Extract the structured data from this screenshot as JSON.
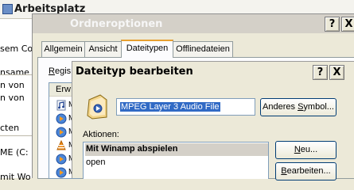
{
  "explorer": {
    "title": "Arbeitsplatz",
    "left_items": [
      "sem Co",
      "nsame",
      "n von",
      "n von",
      "cten",
      "ME (C:",
      "mit Wo"
    ]
  },
  "ordneroptionen": {
    "title": "Ordneroptionen",
    "help_label": "?",
    "close_label": "X",
    "tabs": [
      "Allgemein",
      "Ansicht",
      "Dateitypen",
      "Offlinedateien"
    ],
    "active_tab": "Dateitypen",
    "registered_label_mn": "R",
    "registered_label_rest": "egis",
    "list_header": "Erw",
    "list_rows": [
      {
        "icon": "audio-file-icon",
        "suffix": "M"
      },
      {
        "icon": "media-play-icon",
        "suffix": "M"
      },
      {
        "icon": "media-play-icon",
        "suffix": "M"
      },
      {
        "icon": "vlc-cone-icon",
        "suffix": "M"
      },
      {
        "icon": "media-play-icon",
        "suffix": "M"
      },
      {
        "icon": "media-play-icon",
        "suffix": "M"
      }
    ]
  },
  "dialog": {
    "title": "Dateityp bearbeiten",
    "help_label": "?",
    "close_label": "X",
    "description": "MPEG Layer 3 Audio File",
    "change_icon_pre": "Anderes ",
    "change_icon_mn": "S",
    "change_icon_post": "ymbol...",
    "actions_label": "Aktionen:",
    "actions": [
      "Mit Winamp abspielen",
      "open"
    ],
    "new_pre": "",
    "new_mn": "N",
    "new_post": "eu...",
    "edit_pre": "",
    "edit_mn": "B",
    "edit_post": "earbeiten..."
  }
}
